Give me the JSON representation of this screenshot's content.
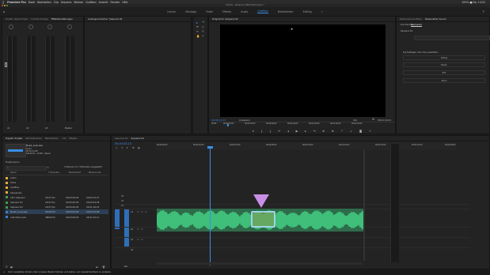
{
  "menubar": {
    "app_name": "Premiere Pro",
    "items": [
      "Datei",
      "Bearbeiten",
      "Clip",
      "Sequenz",
      "Marken",
      "Grafiken",
      "Ansicht",
      "Fenster",
      "Hilfe"
    ],
    "status": "100% ■ Do. 14:22"
  },
  "window_title": "/Users/…/Sequenz_08/Projekt.prproj *",
  "workspaces": {
    "items": [
      "Lernen",
      "Montage",
      "Farbe",
      "Effekte",
      "Audio",
      "Grafiken",
      "Bibliotheken",
      "Editing"
    ],
    "active_index": 5
  },
  "mixer_panel": {
    "tabs": [
      "Quelle: (keine Clips)",
      "Lumetri-Scopes",
      "Effekteinstellungen",
      "Audioclip-Mischer"
    ],
    "channels": [
      "A1",
      "A2",
      "A3",
      "Master"
    ]
  },
  "effect_controls_panel": {
    "tabs": [
      "Audiospurmischer: Sequenz 02"
    ]
  },
  "program_monitor": {
    "tabs": [
      "Programm: Sequenz 02"
    ],
    "timecode": "00;06;12;13",
    "fit_label": "Anpassen",
    "quality_label": "Voll",
    "duration": "00;01;16;01",
    "ruler_ticks": [
      "00;00",
      "00;00;16;00",
      "00;00;32;00",
      "00;00;48;00",
      "00;01;04;00",
      "00;01;20;00",
      "00;01;36;00",
      "00;01;52;00"
    ],
    "transport_icons": [
      "marker-icon",
      "in-point-icon",
      "out-point-icon",
      "goto-in-icon",
      "step-back-icon",
      "play-icon",
      "step-forward-icon",
      "goto-out-icon",
      "insert-icon",
      "overwrite-icon",
      "lift-icon",
      "extract-icon",
      "export-frame-icon",
      "settings-icon"
    ]
  },
  "essential_sound_panel": {
    "tabs": [
      "Essenzielle Grafiken",
      "Essenzieller Sound"
    ],
    "subtabs": [
      "Durchsuchen",
      "Bearbeiten"
    ],
    "sequence_label": "Sequenz 02",
    "heading": "Typ festlegen oder Clip auswählen",
    "options": [
      "Dialog",
      "Musik",
      "SFX",
      "Atmo"
    ]
  },
  "project_panel": {
    "tabs": [
      "Projekt: Projekt",
      "Media-Browser",
      "Bibliotheken",
      "Info",
      "Effekte"
    ],
    "clip_name": "Musik_Loop.wav",
    "clip_info": [
      "Audio",
      "00;02;31;08",
      "44100 Hz - 16 Bit - Stereo"
    ],
    "project_file": "Projekt.prproj",
    "selection_status": "1 Element von 7 Elementen ausgewählt",
    "search_placeholder": "Suchen",
    "columns": [
      "Name",
      "Framerate",
      "Medienstart",
      "Medienende"
    ],
    "bins": [
      {
        "name": "Audio",
        "color": "#e8a93a",
        "fps": "",
        "start": "",
        "end": ""
      },
      {
        "name": "Fotos",
        "color": "#e8a93a",
        "fps": "",
        "start": "",
        "end": ""
      },
      {
        "name": "Grafiken",
        "color": "#e8a93a",
        "fps": "",
        "start": "",
        "end": ""
      },
      {
        "name": "Sequenzen",
        "color": "#e8a93a",
        "fps": "",
        "start": "",
        "end": ""
      },
      {
        "name": "Intro Sequenz",
        "color": "#3f9a52",
        "fps": "29,97 fps",
        "start": "00;00;00;00",
        "end": "00;00;13;27"
      },
      {
        "name": "Sequenz 01",
        "color": "#3f9a52",
        "fps": "29,97 fps",
        "start": "00;00;00;00",
        "end": "00;00;29;28"
      },
      {
        "name": "Sequenz 02",
        "color": "#3f9a52",
        "fps": "29,97 fps",
        "start": "00;00;00;00",
        "end": "00;01;16;01"
      },
      {
        "name": "Musik_Loop.wav",
        "color": "#3a7fd4",
        "fps": "44100 Hz",
        "start": "00;00;00;00",
        "end": "00;02;31;08"
      },
      {
        "name": "Aufnahme.wav",
        "color": "#3a7fd4",
        "fps": "48000 Hz",
        "start": "00;00;00;00",
        "end": "00;01;02;11"
      }
    ]
  },
  "timeline_panel": {
    "tabs": [
      "Sequenz 01",
      "Sequenz 02"
    ],
    "timecode": "00;00;33;13",
    "ruler_ticks": [
      "00;00;00;00",
      "00;00;16;00",
      "00;00;32;00",
      "00;00;48;00",
      "00;01;04;00",
      "00;01;20;00",
      "00;01;36;00",
      "00;01;52;00",
      "00;02;08;00"
    ],
    "tracks": [
      "V3",
      "V2",
      "V1",
      "A1",
      "A2",
      "A3",
      "A4",
      "Mix"
    ]
  },
  "status_bar": {
    "text": "Zum Auswählen klicken oder in leeren Bereich klicken und ziehen, um Auswahlrechteck zu erstellen."
  },
  "colors": {
    "accent": "#3a8ee6",
    "waveform": "#3fbf79",
    "audio_clip": "#2e6b4a",
    "marker": "#c98ee6",
    "playhead": "#3a8ee6",
    "panel": "#232323",
    "background": "#1d1d1d"
  }
}
